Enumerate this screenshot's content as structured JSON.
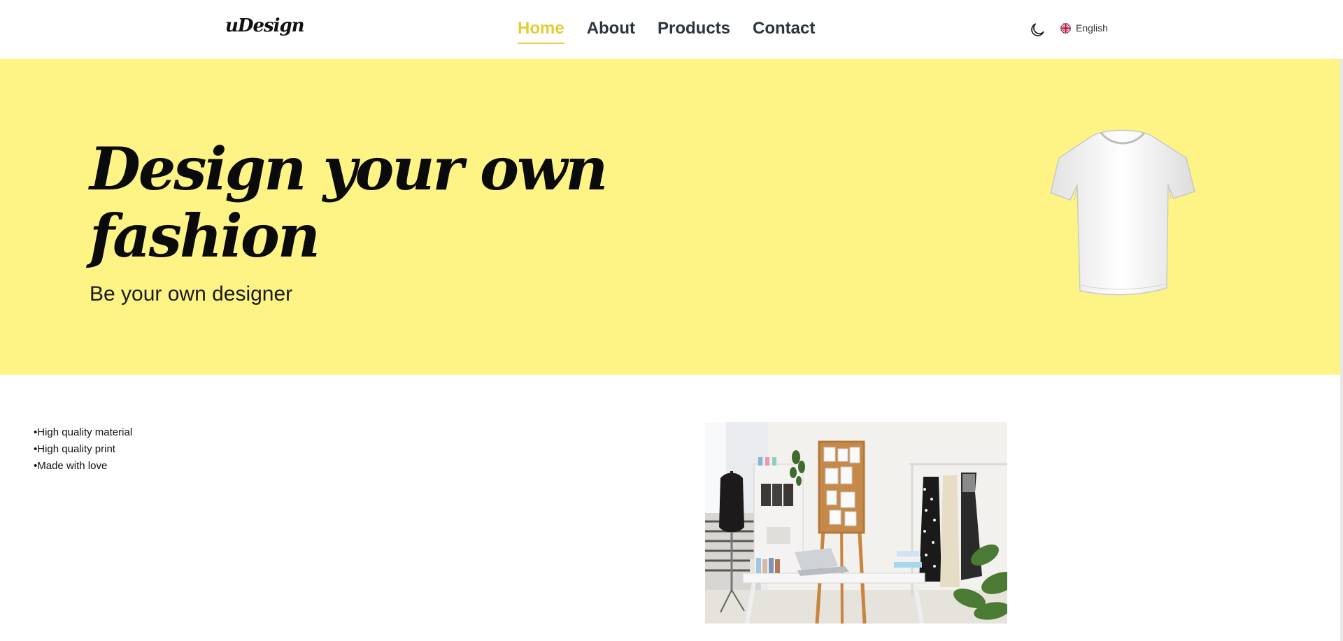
{
  "brand": {
    "logo_text": "uDesign"
  },
  "nav": {
    "links": [
      {
        "label": "Home",
        "active": true
      },
      {
        "label": "About",
        "active": false
      },
      {
        "label": "Products",
        "active": false
      },
      {
        "label": "Contact",
        "active": false
      }
    ]
  },
  "header_controls": {
    "theme_icon": "moon-icon",
    "language": {
      "label": "English",
      "flag_icon": "uk-flag-icon"
    }
  },
  "hero": {
    "title": "Design your own fashion",
    "subtitle": "Be your own designer",
    "image": "white-tshirt",
    "background_color": "#fdf485"
  },
  "features": {
    "items": [
      "•High quality material",
      "•High quality print",
      "•Made with love"
    ]
  },
  "showcase": {
    "image": "fashion-studio-photo"
  },
  "colors": {
    "accent": "#e6cc33",
    "nav_text": "#2c3440"
  }
}
